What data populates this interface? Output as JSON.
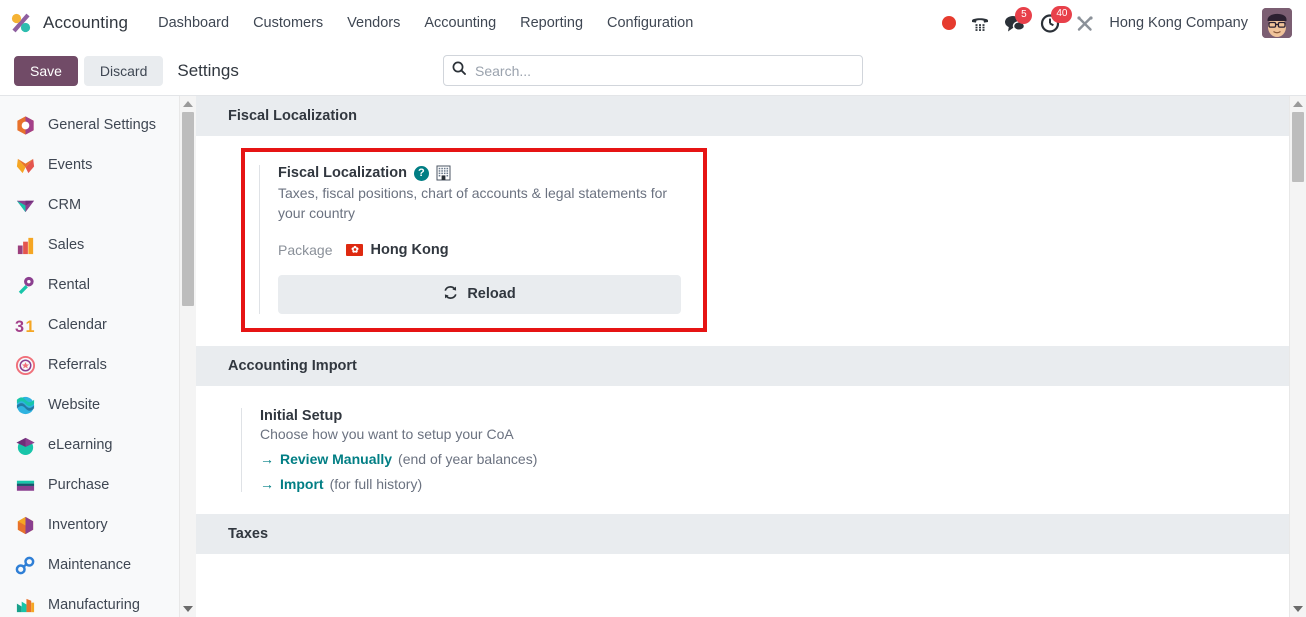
{
  "navbar": {
    "brand": "Accounting",
    "app_icon": "accounting-app-icon",
    "menu": [
      "Dashboard",
      "Customers",
      "Vendors",
      "Accounting",
      "Reporting",
      "Configuration"
    ],
    "systray": {
      "record_indicator": "record-dot-icon",
      "phone_icon": "dialpad-icon",
      "messages_icon": "messages-icon",
      "messages_count": "5",
      "activities_icon": "activities-clock-icon",
      "activities_count": "40",
      "tools_icon": "debug-tools-icon",
      "company": "Hong Kong Company",
      "avatar": "user-avatar"
    }
  },
  "control_panel": {
    "save_label": "Save",
    "discard_label": "Discard",
    "title": "Settings",
    "search_placeholder": "Search...",
    "search_value": ""
  },
  "sidebar": {
    "items": [
      {
        "label": "General Settings",
        "icon": "settings-app-icon"
      },
      {
        "label": "Events",
        "icon": "events-app-icon"
      },
      {
        "label": "CRM",
        "icon": "crm-app-icon"
      },
      {
        "label": "Sales",
        "icon": "sales-app-icon"
      },
      {
        "label": "Rental",
        "icon": "rental-app-icon"
      },
      {
        "label": "Calendar",
        "icon": "calendar-app-icon"
      },
      {
        "label": "Referrals",
        "icon": "referrals-app-icon"
      },
      {
        "label": "Website",
        "icon": "website-app-icon"
      },
      {
        "label": "eLearning",
        "icon": "elearning-app-icon"
      },
      {
        "label": "Purchase",
        "icon": "purchase-app-icon"
      },
      {
        "label": "Inventory",
        "icon": "inventory-app-icon"
      },
      {
        "label": "Maintenance",
        "icon": "maintenance-app-icon"
      },
      {
        "label": "Manufacturing",
        "icon": "manufacturing-app-icon"
      }
    ]
  },
  "main": {
    "sections": {
      "fiscal_localization": {
        "header": "Fiscal Localization",
        "setting_title": "Fiscal Localization",
        "help_glyph": "?",
        "description": "Taxes, fiscal positions, chart of accounts & legal statements for your country",
        "package_label": "Package",
        "package_value": "Hong Kong",
        "package_flag": "hong-kong-flag-icon",
        "reload_label": "Reload",
        "reload_icon": "refresh-icon",
        "highlighted": true,
        "highlight_color": "#e61414"
      },
      "accounting_import": {
        "header": "Accounting Import",
        "setting_title": "Initial Setup",
        "description": "Choose how you want to setup your CoA",
        "links": [
          {
            "arrow": "→",
            "label": "Review Manually",
            "note": "(end of year balances)"
          },
          {
            "arrow": "→",
            "label": "Import",
            "note": "(for full history)"
          }
        ]
      },
      "taxes": {
        "header": "Taxes"
      }
    }
  },
  "colors": {
    "primary": "#714b67",
    "link": "#017e84",
    "section_header_bg": "#e9ecef",
    "highlight": "#e61414",
    "badge": "#e8404a"
  }
}
